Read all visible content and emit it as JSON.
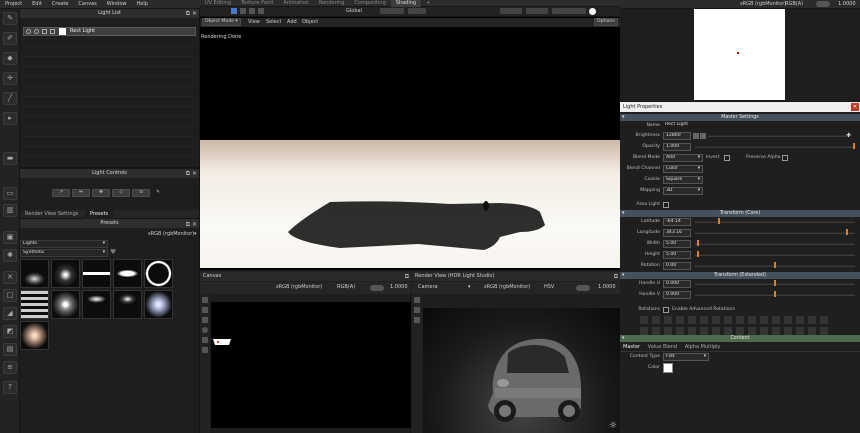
{
  "menubar": {
    "items": [
      "Project",
      "Edit",
      "Create",
      "Canvas",
      "Window",
      "Help"
    ]
  },
  "workspace_tabs": {
    "items": [
      "UV Editing",
      "Texture Paint",
      "Animation",
      "Rendering",
      "Compositing",
      "Shading"
    ],
    "add": "+"
  },
  "right_header": {
    "color_space": "sRGB (rgbMonitor)",
    "channel": "RGB(A)",
    "zoom": "1.0000"
  },
  "light_list": {
    "title": "Light List",
    "item": "Rect Light"
  },
  "light_controls": {
    "title": "Light Controls"
  },
  "tabs_lower_left": {
    "render_view_settings": "Render View Settings",
    "presets": "Presets"
  },
  "presets": {
    "title": "Presets",
    "color_space": "sRGB (rgbMonitor)",
    "category": "Lights",
    "subcategory": "Synthetic"
  },
  "viewport": {
    "mode": "Object Mode",
    "view": "View",
    "select": "Select",
    "add": "Add",
    "object": "Object",
    "transform": "Global",
    "options": "Options",
    "status": "Rendering Done"
  },
  "canvas": {
    "title": "Canvas",
    "color_space": "sRGB (rgbMonitor)",
    "channel": "RGB(A)",
    "zoom": "1.0000"
  },
  "render_view": {
    "title": "Render View (HDR Light Studio)",
    "camera": "Camera",
    "color_space": "sRGB (rgbMonitor)",
    "mode": "HSV",
    "zoom": "1.0000"
  },
  "light_properties": {
    "title": "Light Properties",
    "master_settings": "Master Settings",
    "name_label": "Name",
    "name": "Rect Light",
    "brightness_label": "Brightness",
    "brightness": "12800",
    "opacity_label": "Opacity",
    "opacity": "1.000",
    "blend_mode_label": "Blend Mode",
    "blend_mode": "Add",
    "invert_label": "Invert",
    "preserve_alpha_label": "Preserve Alpha",
    "blend_channel_label": "Blend Channel",
    "blend_channel": "Color",
    "cookie_label": "Cookie",
    "cookie": "Square",
    "mapping_label": "Mapping",
    "mapping": "3D",
    "area_light_label": "Area Light",
    "transform_core": "Transform (Core)",
    "latitude_label": "Latitude",
    "latitude": "-64.14",
    "longitude_label": "Longitude",
    "longitude": "343.16",
    "width_label": "Width",
    "width": "5.00",
    "height_label": "Height",
    "height": "5.00",
    "rotation_label": "Rotation",
    "rotation": "0.00",
    "transform_extended": "Transform (Extended)",
    "handle_u_label": "Handle U",
    "handle_u": "0.000",
    "handle_v_label": "Handle V",
    "handle_v": "0.000",
    "rotations_label": "Rotations",
    "enable_adv_label": "Enable Advanced Rotations",
    "content": "Content",
    "content_tabs": [
      "Master",
      "Value Blend",
      "Alpha Multiply"
    ],
    "content_type_label": "Content Type",
    "content_type": "Flat",
    "color_label": "Color",
    "color": "#ffffff"
  },
  "colors": {
    "accent": "#e08020",
    "section": "#45525e",
    "content_section": "#4f6a4f",
    "close": "#c0392b"
  }
}
